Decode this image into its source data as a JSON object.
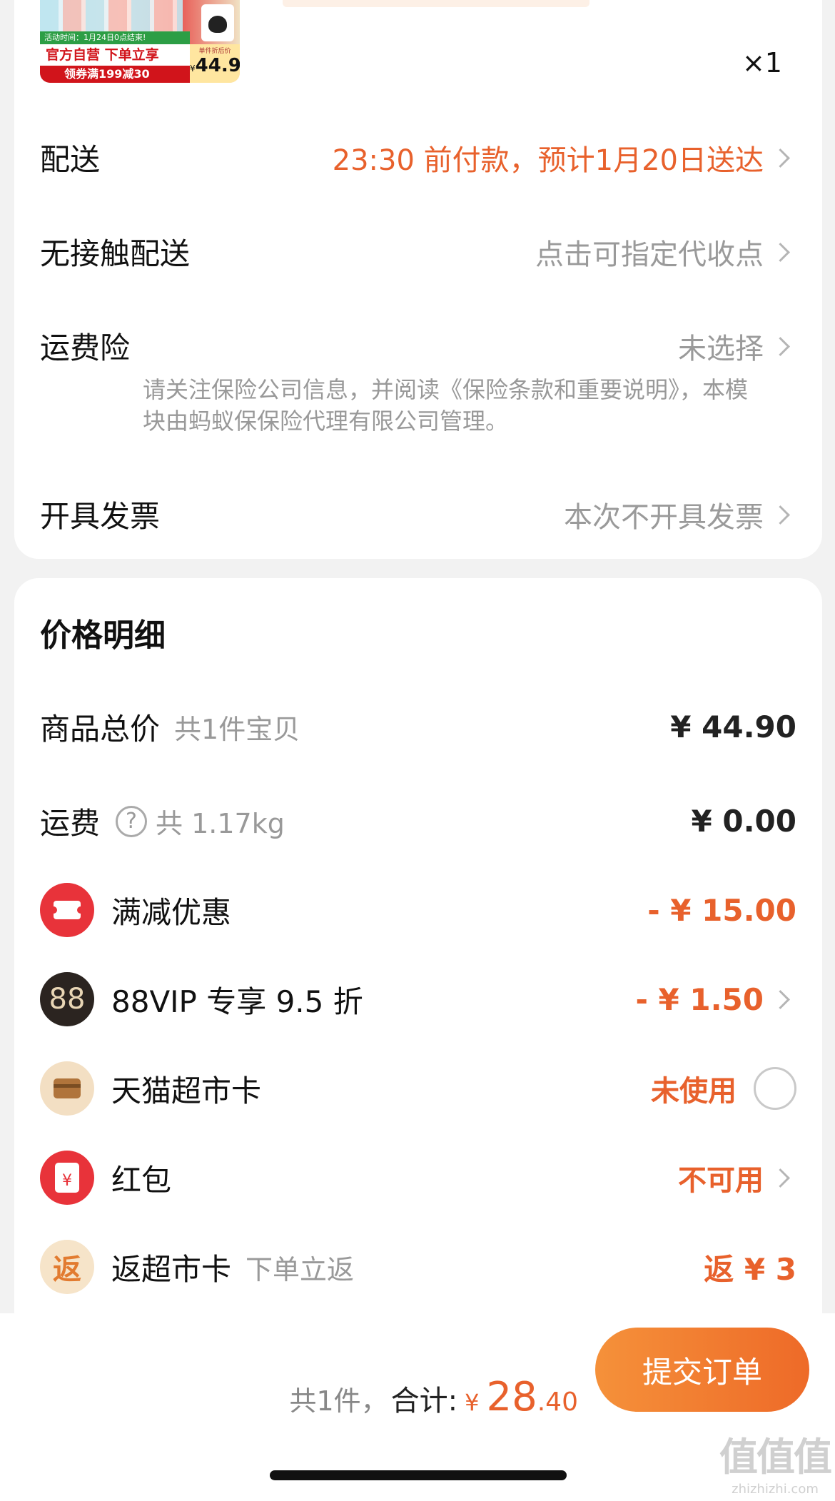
{
  "product": {
    "thumb_ribbon": "活动时间：1月24日0点结束!",
    "thumb_line1": "官方自营 下单立享",
    "thumb_line2": "领券满199减30",
    "thumb_price_label": "单件折后价",
    "thumb_price_symbol": "¥",
    "thumb_price": "44.9",
    "quantity": "×1"
  },
  "order_options": {
    "delivery": {
      "label": "配送",
      "value": "23:30 前付款，预计1月20日送达"
    },
    "contactless": {
      "label": "无接触配送",
      "value": "点击可指定代收点"
    },
    "shipping_insurance": {
      "label": "运费险",
      "value": "未选择",
      "note": "请关注保险公司信息，并阅读《保险条款和重要说明》，本模块由蚂蚁保保险代理有限公司管理。"
    },
    "invoice": {
      "label": "开具发票",
      "value": "本次不开具发票"
    }
  },
  "price_detail": {
    "title": "价格明细",
    "goods_total": {
      "label": "商品总价",
      "sub": "共1件宝贝",
      "value": "¥ 44.90"
    },
    "shipping": {
      "label": "运费",
      "sub": "共 1.17kg",
      "value": "¥ 0.00"
    },
    "full_discount": {
      "label": "满减优惠",
      "value": "- ¥ 15.00",
      "icon": "coupon-ticket-icon"
    },
    "vip": {
      "label": "88VIP 专享 9.5 折",
      "value": "- ¥ 1.50",
      "icon_text": "88"
    },
    "market_card": {
      "label": "天猫超市卡",
      "value": "未使用",
      "icon": "card-icon"
    },
    "red_packet": {
      "label": "红包",
      "value": "不可用",
      "icon_text": "¥"
    },
    "rebate_card": {
      "label": "返超市卡",
      "sub": "下单立返",
      "value": "返 ¥ 3",
      "icon_text": "返"
    }
  },
  "footer": {
    "count": "共1件，",
    "total_label": "合计:",
    "currency": "¥",
    "total_int": "28",
    "total_dec": ".40",
    "submit": "提交订单"
  },
  "watermark": {
    "line1": "值值值",
    "line2": "zhizhizhi.com"
  },
  "colors": {
    "accent": "#e8612c",
    "submit_gradient_start": "#f5913a",
    "submit_gradient_end": "#ee6a28"
  }
}
